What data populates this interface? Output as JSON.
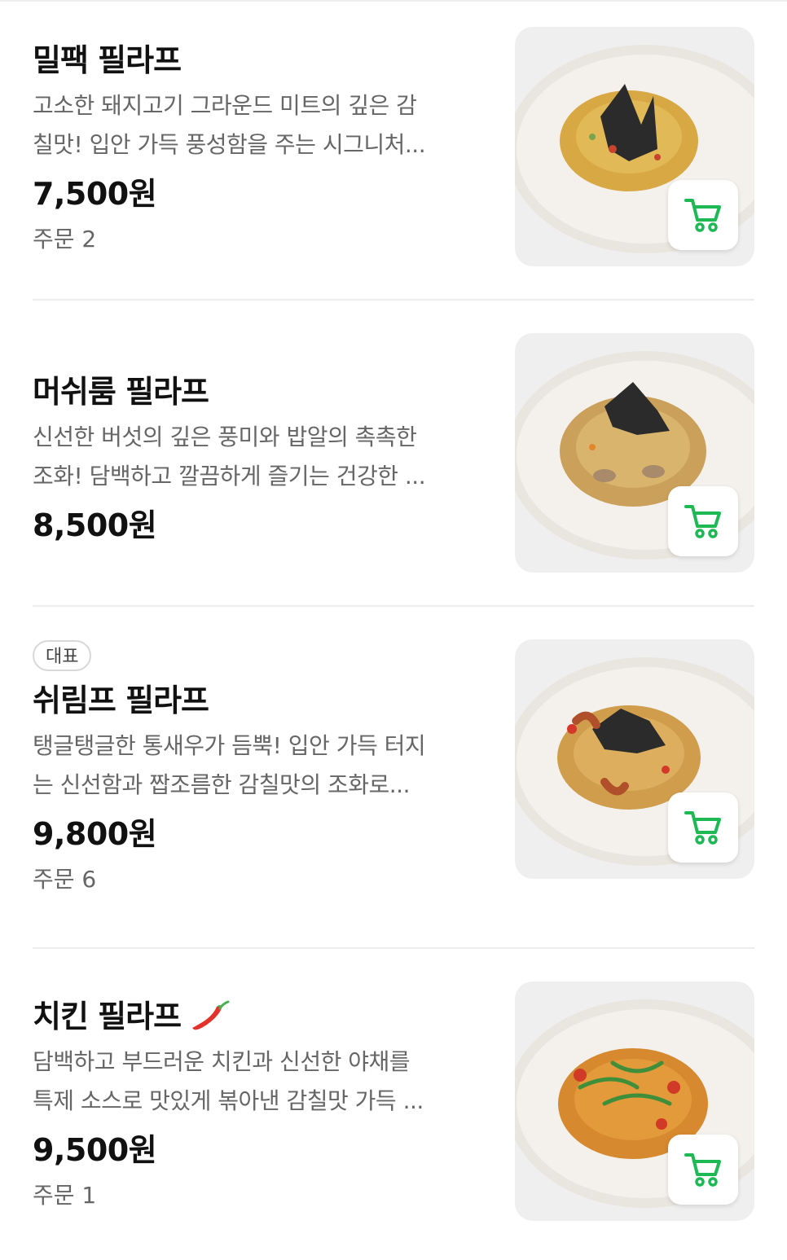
{
  "colors": {
    "accent": "#1db954",
    "text": "#111111",
    "muted": "#666666"
  },
  "items": [
    {
      "name": "밀팩 필라프",
      "desc_line1": "고소한 돼지고기 그라운드 미트의 깊은 감",
      "desc_line2": "칠맛! 입안 가득 풍성함을 주는 시그니처...",
      "price": "7,500원",
      "orders": "주문 2",
      "badge": "",
      "spicy": false,
      "image": "rice-plate-seaweed",
      "cart_icon": "cart-icon"
    },
    {
      "name": "머쉬룸 필라프",
      "desc_line1": "신선한 버섯의 깊은 풍미와 밥알의 촉촉한",
      "desc_line2": "조화! 담백하고 깔끔하게 즐기는 건강한 ...",
      "price": "8,500원",
      "orders": "",
      "badge": "",
      "spicy": false,
      "image": "rice-plate-mushroom",
      "cart_icon": "cart-icon"
    },
    {
      "name": "쉬림프 필라프",
      "desc_line1": "탱글탱글한 통새우가 듬뿍! 입안 가득 터지",
      "desc_line2": "는 신선함과 짭조름한 감칠맛의 조화로...",
      "price": "9,800원",
      "orders": "주문 6",
      "badge": "대표",
      "spicy": false,
      "image": "rice-plate-shrimp",
      "cart_icon": "cart-icon"
    },
    {
      "name": "치킨 필라프",
      "desc_line1": "담백하고 부드러운 치킨과 신선한 야채를",
      "desc_line2": "특제 소스로 맛있게 볶아낸 감칠맛 가득 ...",
      "price": "9,500원",
      "orders": "주문 1",
      "badge": "",
      "spicy": true,
      "image": "rice-plate-chicken",
      "cart_icon": "cart-icon"
    }
  ]
}
